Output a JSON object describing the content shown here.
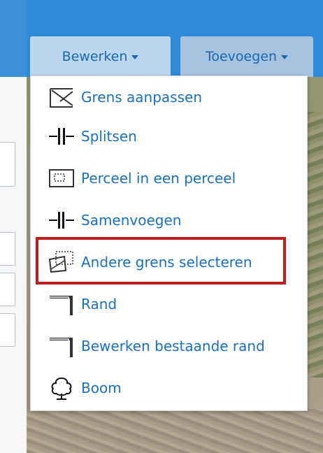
{
  "toolbar": {
    "edit_label": "Bewerken",
    "add_label": "Toevoegen"
  },
  "menu": {
    "items": [
      {
        "label": "Grens aanpassen",
        "icon": "adjust-boundary-icon"
      },
      {
        "label": "Splitsen",
        "icon": "split-icon"
      },
      {
        "label": "Perceel in een perceel",
        "icon": "parcel-in-parcel-icon"
      },
      {
        "label": "Samenvoegen",
        "icon": "merge-icon"
      },
      {
        "label": "Andere grens selecteren",
        "icon": "select-other-boundary-icon",
        "highlighted": true
      },
      {
        "label": "Rand",
        "icon": "edge-icon"
      },
      {
        "label": "Bewerken bestaande rand",
        "icon": "edit-existing-edge-icon"
      },
      {
        "label": "Boom",
        "icon": "tree-icon"
      }
    ]
  },
  "colors": {
    "topbar": "#2f8ad8",
    "menu_text": "#1a6fbf",
    "highlight_border": "#c01d1d"
  }
}
